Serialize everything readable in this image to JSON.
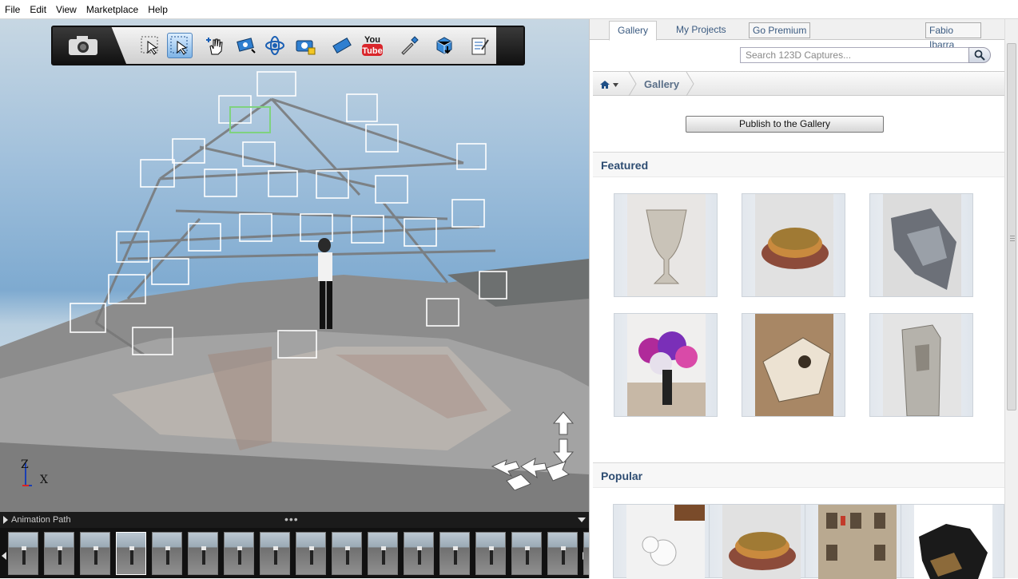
{
  "menubar": {
    "items": [
      "File",
      "Edit",
      "View",
      "Marketplace",
      "Help"
    ]
  },
  "toolbar": {
    "tools": [
      "select-icon",
      "select-active-icon",
      "hand-add-icon",
      "camera-move-icon",
      "orbit-icon",
      "camera-lock-icon",
      "film-icon",
      "youtube-icon",
      "eyedropper-icon",
      "cube-download-icon",
      "notes-icon"
    ],
    "youtube_top": "You",
    "youtube_bottom": "Tube"
  },
  "viewport": {
    "axis_z": "Z",
    "axis_x": "X"
  },
  "filmstrip": {
    "title": "Animation Path",
    "dots": "•••",
    "frame_count": 17
  },
  "panel": {
    "tabs": {
      "gallery": "Gallery",
      "my_projects": "My Projects",
      "go_premium": "Go Premium",
      "user": "Fabio Ibarra"
    },
    "search": {
      "placeholder": "Search 123D Captures..."
    },
    "breadcrumb": {
      "current": "Gallery"
    },
    "publish_label": "Publish to the Gallery",
    "featured_title": "Featured",
    "popular_title": "Popular",
    "featured_items": [
      "urn-model",
      "quiche-model",
      "metal-object-model",
      "flower-bouquet-model",
      "animal-skull-model",
      "stone-monument-model"
    ],
    "popular_items": [
      "toy-figure-model",
      "quiche-model",
      "building-facade-model",
      "black-animal-model"
    ]
  },
  "colors": {
    "panel_link": "#3a5a80",
    "section_title": "#2e4d72",
    "active_tool": "#7db3e6"
  }
}
